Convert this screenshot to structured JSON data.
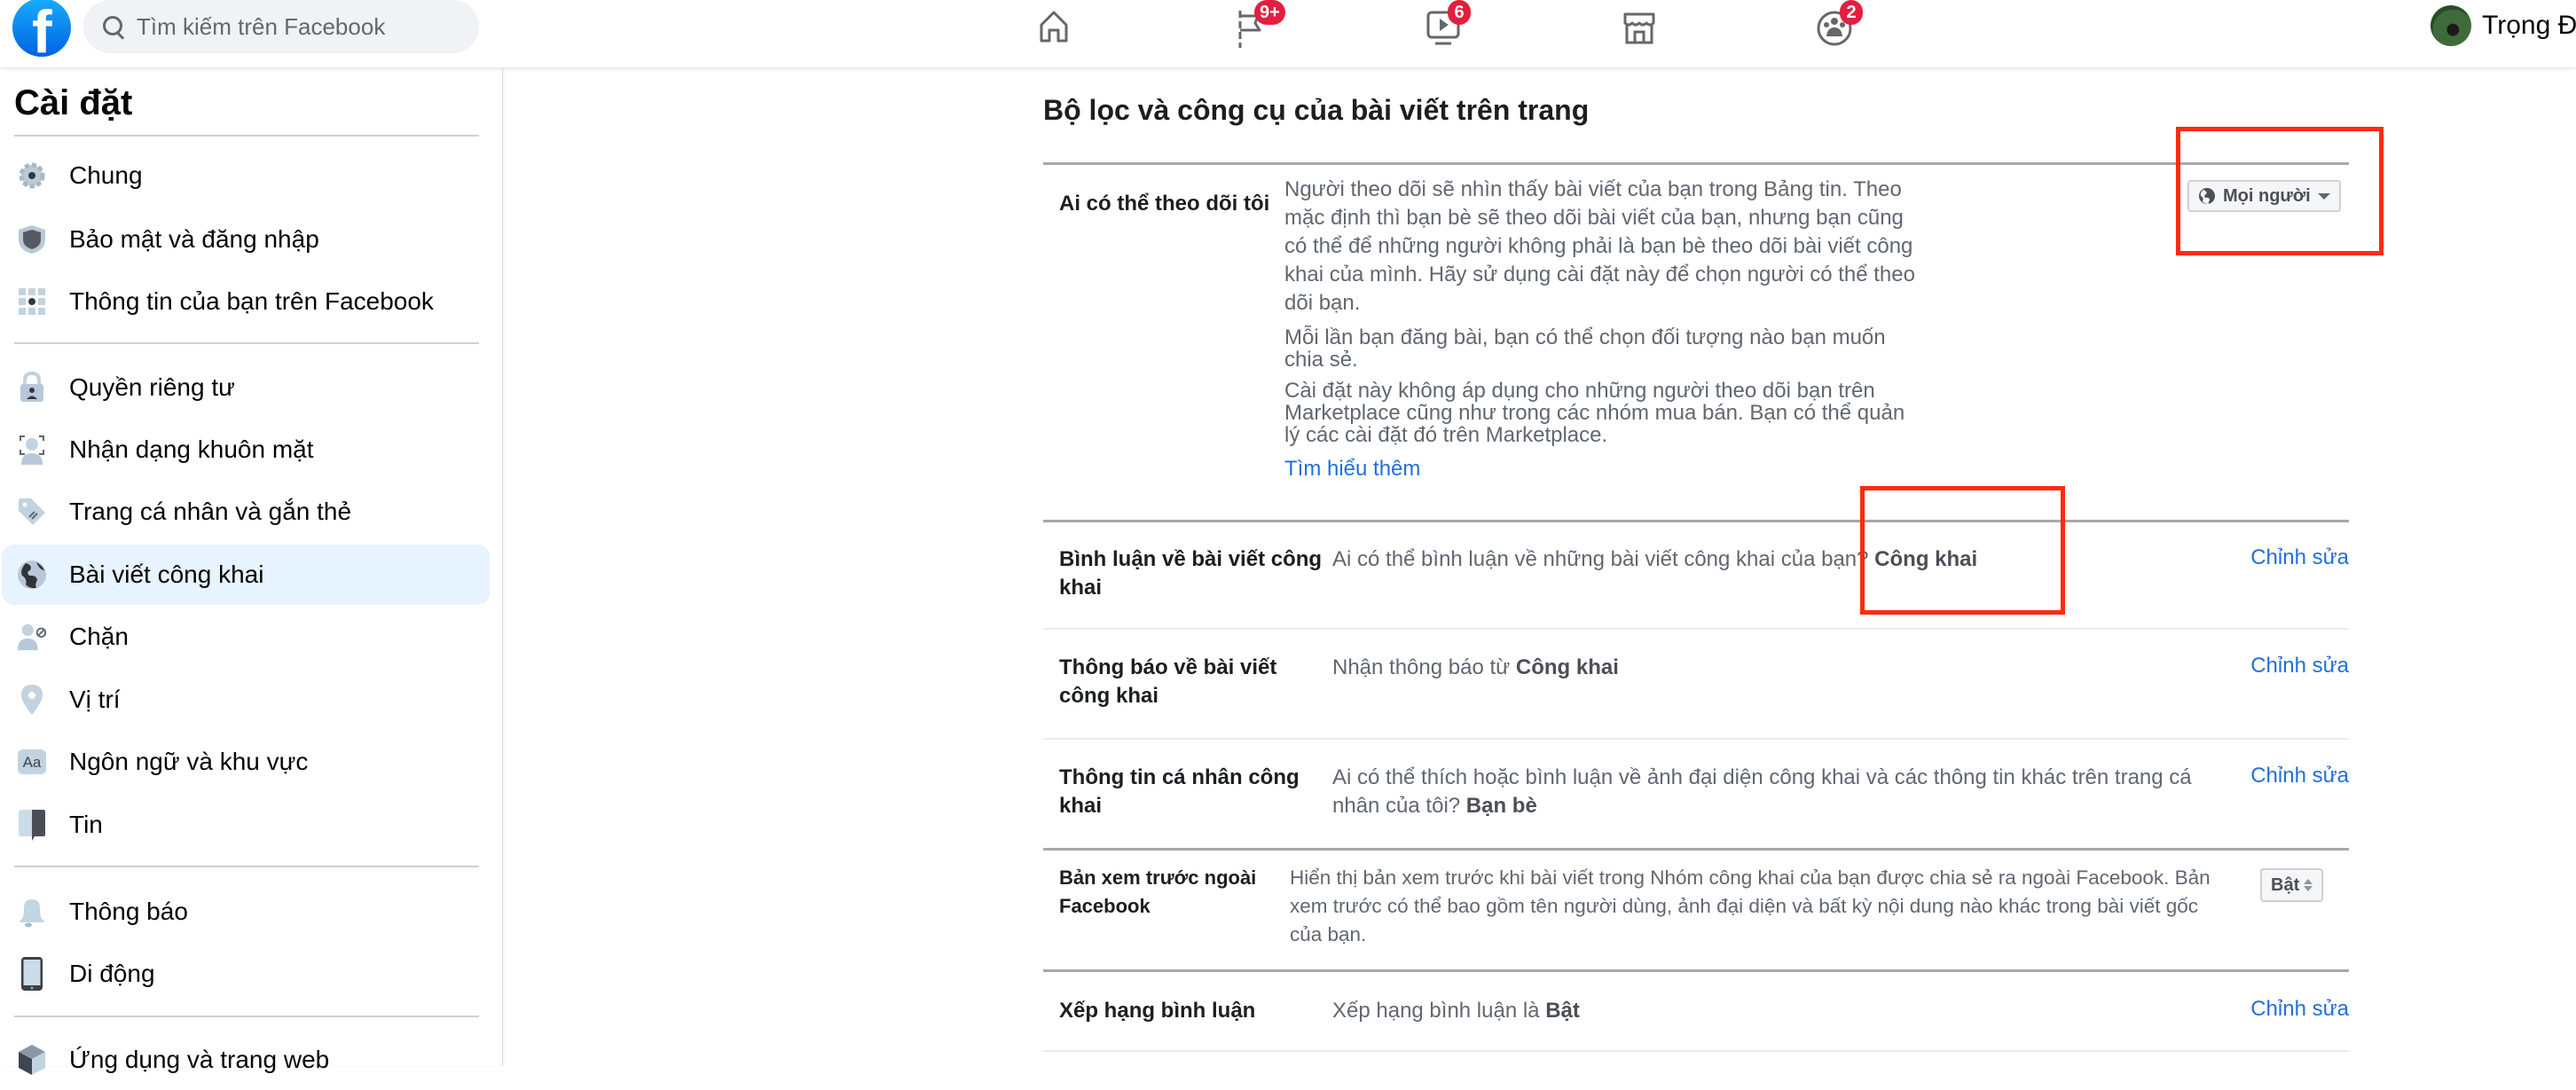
{
  "header": {
    "logo": "facebook-logo",
    "search_placeholder": "Tìm kiếm trên Facebook",
    "nav": [
      {
        "name": "home",
        "icon": "home-icon",
        "badge": null
      },
      {
        "name": "pages",
        "icon": "flag-icon",
        "badge": "9+"
      },
      {
        "name": "watch",
        "icon": "video-icon",
        "badge": "6"
      },
      {
        "name": "marketplace",
        "icon": "store-icon",
        "badge": null
      },
      {
        "name": "groups",
        "icon": "groups-icon",
        "badge": "2"
      }
    ],
    "user_name": "Trọng Đạ",
    "badge_color": "#e41e3f",
    "brand_color": "#1877f2"
  },
  "sidebar": {
    "title": "Cài đặt",
    "items": [
      {
        "label": "Chung",
        "icon": "gear-icon"
      },
      {
        "label": "Bảo mật và đăng nhập",
        "icon": "shield-icon"
      },
      {
        "label": "Thông tin của bạn trên Facebook",
        "icon": "grid-icon"
      },
      {
        "label": "Quyền riêng tư",
        "icon": "lock-icon"
      },
      {
        "label": "Nhận dạng khuôn mặt",
        "icon": "face-scan-icon"
      },
      {
        "label": "Trang cá nhân và gắn thẻ",
        "icon": "tag-icon"
      },
      {
        "label": "Bài viết công khai",
        "icon": "globe-icon",
        "active": true
      },
      {
        "label": "Chặn",
        "icon": "block-user-icon"
      },
      {
        "label": "Vị trí",
        "icon": "location-pin-icon"
      },
      {
        "label": "Ngôn ngữ và khu vực",
        "icon": "language-icon"
      },
      {
        "label": "Tin",
        "icon": "stories-icon"
      },
      {
        "label": "Thông báo",
        "icon": "bell-icon"
      },
      {
        "label": "Di động",
        "icon": "phone-icon"
      },
      {
        "label": "Ứng dụng và trang web",
        "icon": "apps-cube-icon"
      }
    ]
  },
  "main": {
    "title": "Bộ lọc và công cụ của bài viết trên trang",
    "follow": {
      "label": "Ai có thể theo dõi tôi",
      "paragraphs": [
        "Người theo dõi sẽ nhìn thấy bài viết của bạn trong Bảng tin. Theo mặc định thì bạn bè sẽ theo dõi bài viết của bạn, nhưng bạn cũng có thể để những người không phải là bạn bè theo dõi bài viết công khai của mình. Hãy sử dụng cài đặt này để chọn người có thể theo dõi bạn.",
        "Mỗi lần bạn đăng bài, bạn có thể chọn đối tượng nào bạn muốn chia sẻ.",
        "Cài đặt này không áp dụng cho những người theo dõi bạn trên Marketplace cũng như trong các nhóm mua bán. Bạn có thể quản lý các cài đặt đó trên Marketplace."
      ],
      "learn_more": "Tìm hiểu thêm",
      "selected_audience": "Mọi người"
    },
    "rows": [
      {
        "label": "Bình luận về bài viết công khai",
        "desc": "Ai có thể bình luận về những bài viết công khai của bạn?",
        "value": "Công khai",
        "action": "Chỉnh sửa"
      },
      {
        "label": "Thông báo về bài viết công khai",
        "desc": "Nhận thông báo từ",
        "value": "Công khai",
        "action": "Chỉnh sửa"
      },
      {
        "label": "Thông tin cá nhân công khai",
        "desc": "Ai có thể thích hoặc bình luận về ảnh đại diện công khai và các thông tin khác trên trang cá nhân của tôi?",
        "value": "Bạn bè",
        "action": "Chỉnh sửa"
      },
      {
        "label": "Bản xem trước ngoài Facebook",
        "desc": "Hiển thị bản xem trước khi bài viết trong Nhóm công khai của bạn được chia sẻ ra ngoài Facebook. Bản xem trước có thể bao gồm tên người dùng, ảnh đại diện và bất kỳ nội dung nào khác trong bài viết gốc của bạn.",
        "select_value": "Bật"
      },
      {
        "label": "Xếp hạng bình luận",
        "desc": "Xếp hạng bình luận là",
        "value": "Bật",
        "action": "Chỉnh sửa"
      }
    ],
    "link_color": "#216fdb",
    "annotation_color": "#ff2a12"
  }
}
